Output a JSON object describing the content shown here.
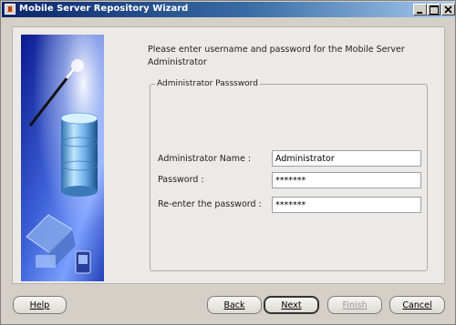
{
  "window": {
    "title": "Mobile Server Repository Wizard"
  },
  "intro_text": "Please enter username and password for the Mobile Server Administrator",
  "group": {
    "legend": "Administrator Passsword"
  },
  "form": {
    "name_label": "Administrator Name :",
    "name_value": "Administrator",
    "password_label": "Password :",
    "password_value": "*******",
    "reenter_label": "Re-enter the password :",
    "reenter_value": "*******"
  },
  "buttons": {
    "help": "Help",
    "back": "Back",
    "next": "Next",
    "finish": "Finish",
    "cancel": "Cancel"
  },
  "icons": [
    "app-icon",
    "minimize-icon",
    "maximize-icon",
    "close-icon",
    "wizard-graphic"
  ],
  "colors": {
    "titlebar_start": "#0a246a",
    "titlebar_end": "#a6caf0",
    "window_bg": "#d4d0c8",
    "panel_bg": "#ebeae6"
  }
}
